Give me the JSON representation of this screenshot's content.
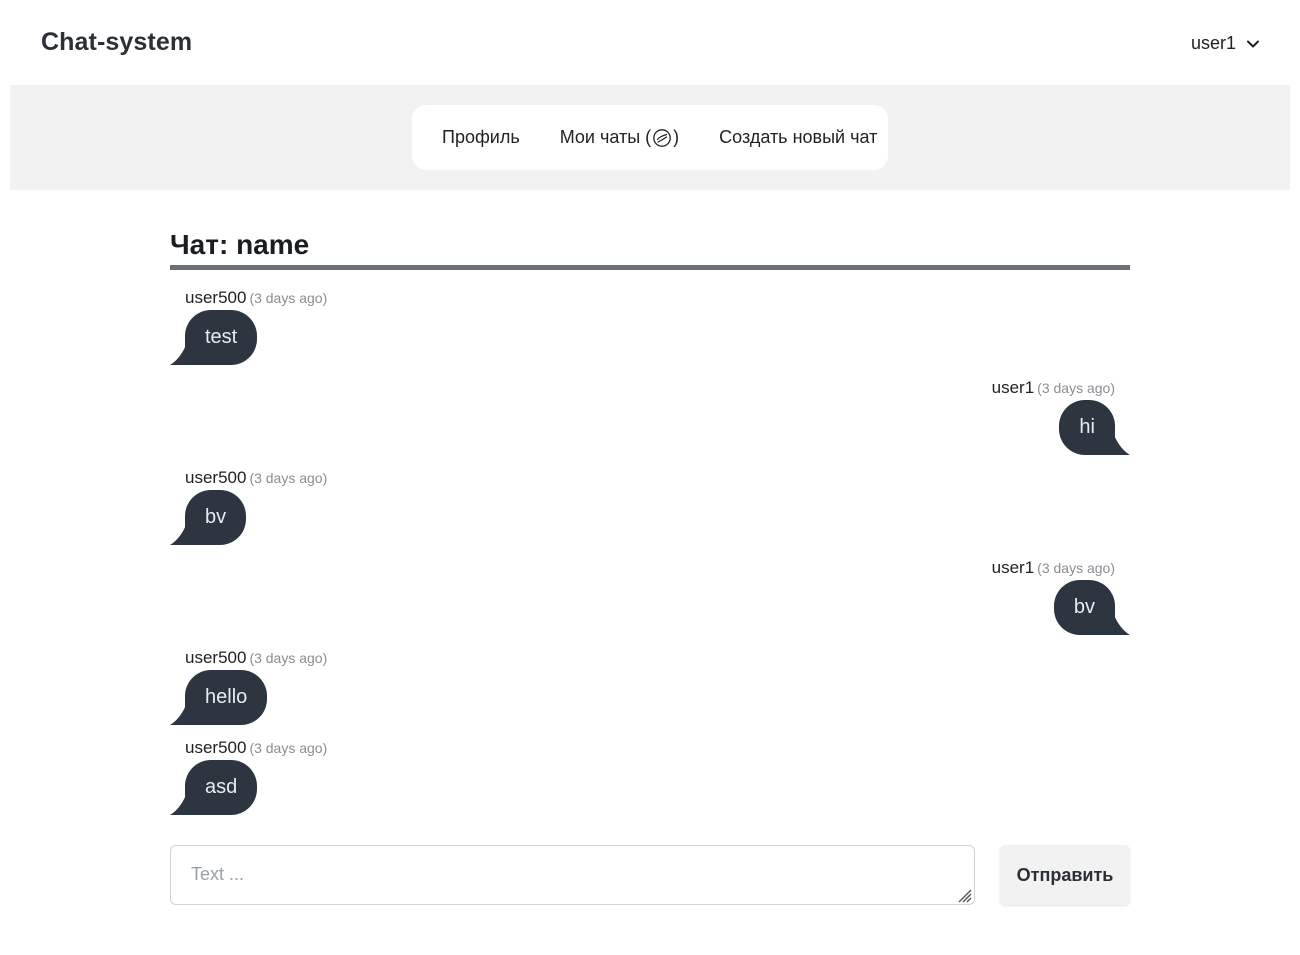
{
  "header": {
    "brand": "Chat-system",
    "user": "user1",
    "user_menu_icon": "chevron-down-icon"
  },
  "nav": {
    "items": [
      {
        "label": "Профиль"
      },
      {
        "label_before": "Мои чаты (",
        "icon": "chat-bubbles-icon",
        "label_after": ")"
      },
      {
        "label": "Создать новый чат"
      }
    ]
  },
  "chat": {
    "title": "Чат: name",
    "messages": [
      {
        "author": "user500",
        "time": "(3 days ago)",
        "text": "test",
        "side": "left"
      },
      {
        "author": "user1",
        "time": "(3 days ago)",
        "text": "hi",
        "side": "right"
      },
      {
        "author": "user500",
        "time": "(3 days ago)",
        "text": "bv",
        "side": "left"
      },
      {
        "author": "user1",
        "time": "(3 days ago)",
        "text": "bv",
        "side": "right"
      },
      {
        "author": "user500",
        "time": "(3 days ago)",
        "text": "hello",
        "side": "left"
      },
      {
        "author": "user500",
        "time": "(3 days ago)",
        "text": "asd",
        "side": "left"
      }
    ]
  },
  "composer": {
    "placeholder": "Text ...",
    "value": "",
    "send_label": "Отправить"
  },
  "colors": {
    "bubble": "#2d3541",
    "bubble_text": "#e9ecef",
    "nav_band": "#f2f2f2",
    "title_rule": "#6b6f7a"
  }
}
